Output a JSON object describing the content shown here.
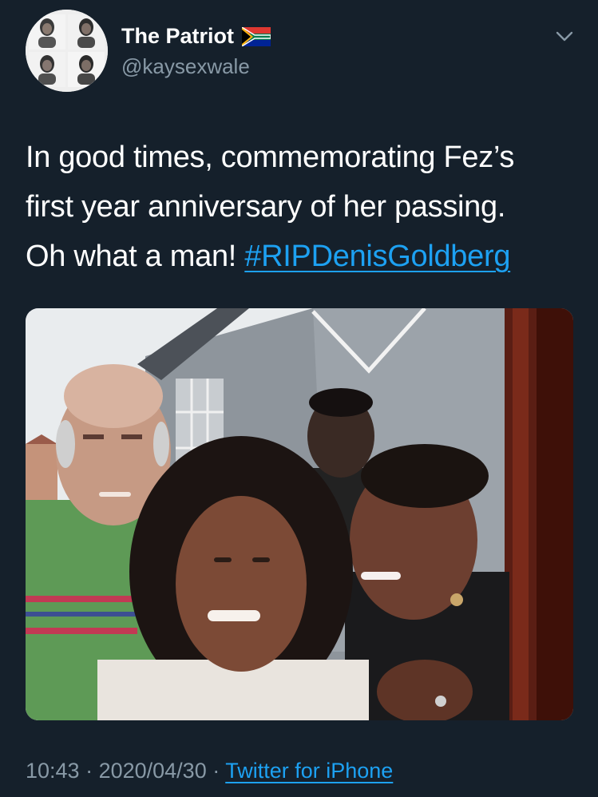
{
  "author": {
    "display_name": "The Patriot",
    "handle": "@kaysexwale",
    "flag_icon": "south-africa-flag-emoji"
  },
  "tweet": {
    "lines": [
      "In good times, commemorating Fez’s",
      "first year anniversary of her passing.",
      "Oh what a man! "
    ],
    "hashtag": "#RIPDenisGoldberg"
  },
  "meta": {
    "time": "10:43",
    "separator": " · ",
    "date": "2020/04/30",
    "source": "Twitter for iPhone"
  },
  "colors": {
    "background": "#15202b",
    "primary_text": "#ffffff",
    "secondary_text": "#8899a6",
    "accent": "#1da1f2"
  }
}
